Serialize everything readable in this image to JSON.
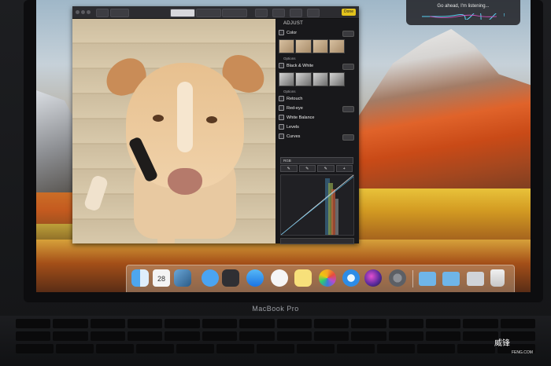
{
  "siri": {
    "prompt": "Go ahead, I'm listening..."
  },
  "photos_window": {
    "toolbar": {
      "tab_labels": [
        "Adjust",
        "Filters",
        "Crop"
      ],
      "done_label": "Done"
    },
    "sidebar": {
      "title": "ADJUST",
      "sections": [
        {
          "label": "Color",
          "value": "AUTO"
        },
        {
          "label": "Options"
        },
        {
          "label": "Black & White",
          "value": "AUTO"
        },
        {
          "label": "Options"
        },
        {
          "label": "Retouch"
        },
        {
          "label": "Red-eye"
        },
        {
          "label": "White Balance"
        },
        {
          "label": "Levels"
        },
        {
          "label": "Curves",
          "value": "AUTO"
        }
      ],
      "curves_channel": "RGB",
      "curves_add_label": "Add Point"
    }
  },
  "dock": {
    "calendar_day": "28",
    "apps": [
      "finder-icon",
      "calendar-icon",
      "preview-icon",
      "messages-icon",
      "photo-booth-icon",
      "app-store-icon",
      "itunes-icon",
      "notes-icon",
      "photos-icon",
      "safari-icon",
      "siri-icon",
      "system-preferences-icon",
      "folder-icon",
      "folder-icon",
      "downloads-icon",
      "trash-icon"
    ]
  },
  "laptop": {
    "brand": "MacBook Pro"
  },
  "watermark": {
    "text": "威锋",
    "sub": "FENG.COM"
  }
}
